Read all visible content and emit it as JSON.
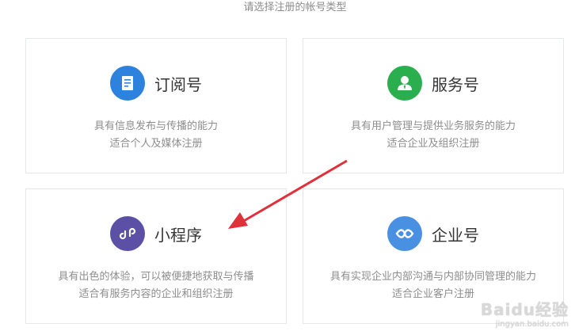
{
  "header": {
    "title": "请选择注册的帐号类型"
  },
  "cards": [
    {
      "name": "订阅号",
      "icon": "document-icon",
      "color": "#2c82dc",
      "desc_line1": "具有信息发布与传播的能力",
      "desc_line2": "适合个人及媒体注册"
    },
    {
      "name": "服务号",
      "icon": "user-icon",
      "color": "#2aae4e",
      "desc_line1": "具有用户管理与提供业务服务的能力",
      "desc_line2": "适合企业及组织注册"
    },
    {
      "name": "小程序",
      "icon": "miniprogram-icon",
      "color": "#5c4fa6",
      "desc_line1": "具有出色的体验，可以被便捷地获取与传播",
      "desc_line2": "适合有服务内容的企业和组织注册"
    },
    {
      "name": "企业号",
      "icon": "enterprise-icon",
      "color": "#4a90e2",
      "desc_line1": "具有实现企业内部沟通与内部协同管理的能力",
      "desc_line2": "适合企业客户注册"
    }
  ],
  "annotation": {
    "arrow_color": "#e0303a"
  },
  "watermark": {
    "brand": "Baidu经验",
    "url": "jingyan.baidu.com"
  }
}
